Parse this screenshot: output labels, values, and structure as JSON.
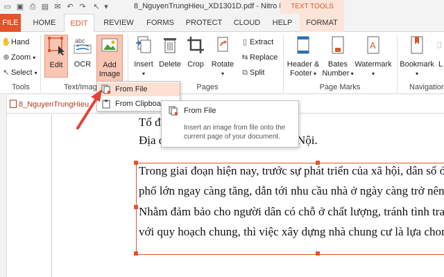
{
  "titlebar": {
    "title": "8_NguyenTrungHieu_XD1301D.pdf - Nitro Pro 10",
    "context_label": "TEXT TOOLS"
  },
  "tabs": [
    "FILE",
    "HOME",
    "EDIT",
    "REVIEW",
    "FORMS",
    "PROTECT",
    "CLOUD",
    "HELP",
    "FORMAT"
  ],
  "active_tab": "EDIT",
  "ribbon": {
    "tools": {
      "label": "Tools",
      "hand": "Hand",
      "zoom": "Zoom",
      "select": "Select"
    },
    "text_image": {
      "label": "Text/Image",
      "edit": "Edit",
      "ocr": "OCR",
      "add_image_1": "Add",
      "add_image_2": "Image"
    },
    "pages": {
      "label": "Pages",
      "insert": "Insert",
      "delete": "Delete",
      "crop": "Crop",
      "rotate": "Rotate",
      "extract": "Extract",
      "replace": "Replace",
      "split": "Split"
    },
    "page_marks": {
      "label": "Page Marks",
      "header_1": "Header &",
      "header_2": "Footer",
      "bates_1": "Bates",
      "bates_2": "Number",
      "watermark": "Watermark"
    },
    "navigation": {
      "label": "Navigation",
      "bookmark": "Bookmark",
      "l": "L"
    }
  },
  "document": {
    "tab_name": "8_NguyenTrungHieu",
    "line0": "Tổ đ",
    "line1": "Địa đ",
    "line1_end": "Nội.",
    "para": [
      "Trong giai đoạn hiện nay,  trước sự phát triển của xã hội, dân số ở",
      "phố lớn ngay càng tăng, dẫn tới nhu cầu nhà ở ngày càng trở nên c",
      "Nhằm đảm bảo cho người dân có chỗ ở chất lượng, tránh tình tran",
      "với quy hoạch chung, thì việc xây dựng nhà chung cư là lựa chon c"
    ]
  },
  "dropdown": {
    "from_file": "From File",
    "from_clipboard": "From Clipboard"
  },
  "tooltip": {
    "title": "From File",
    "description": "Insert an image from file onto the current page of your document."
  },
  "colors": {
    "accent": "#e2542a",
    "context_tab": "#fde4d8",
    "active_button": "#f9c6b4"
  }
}
